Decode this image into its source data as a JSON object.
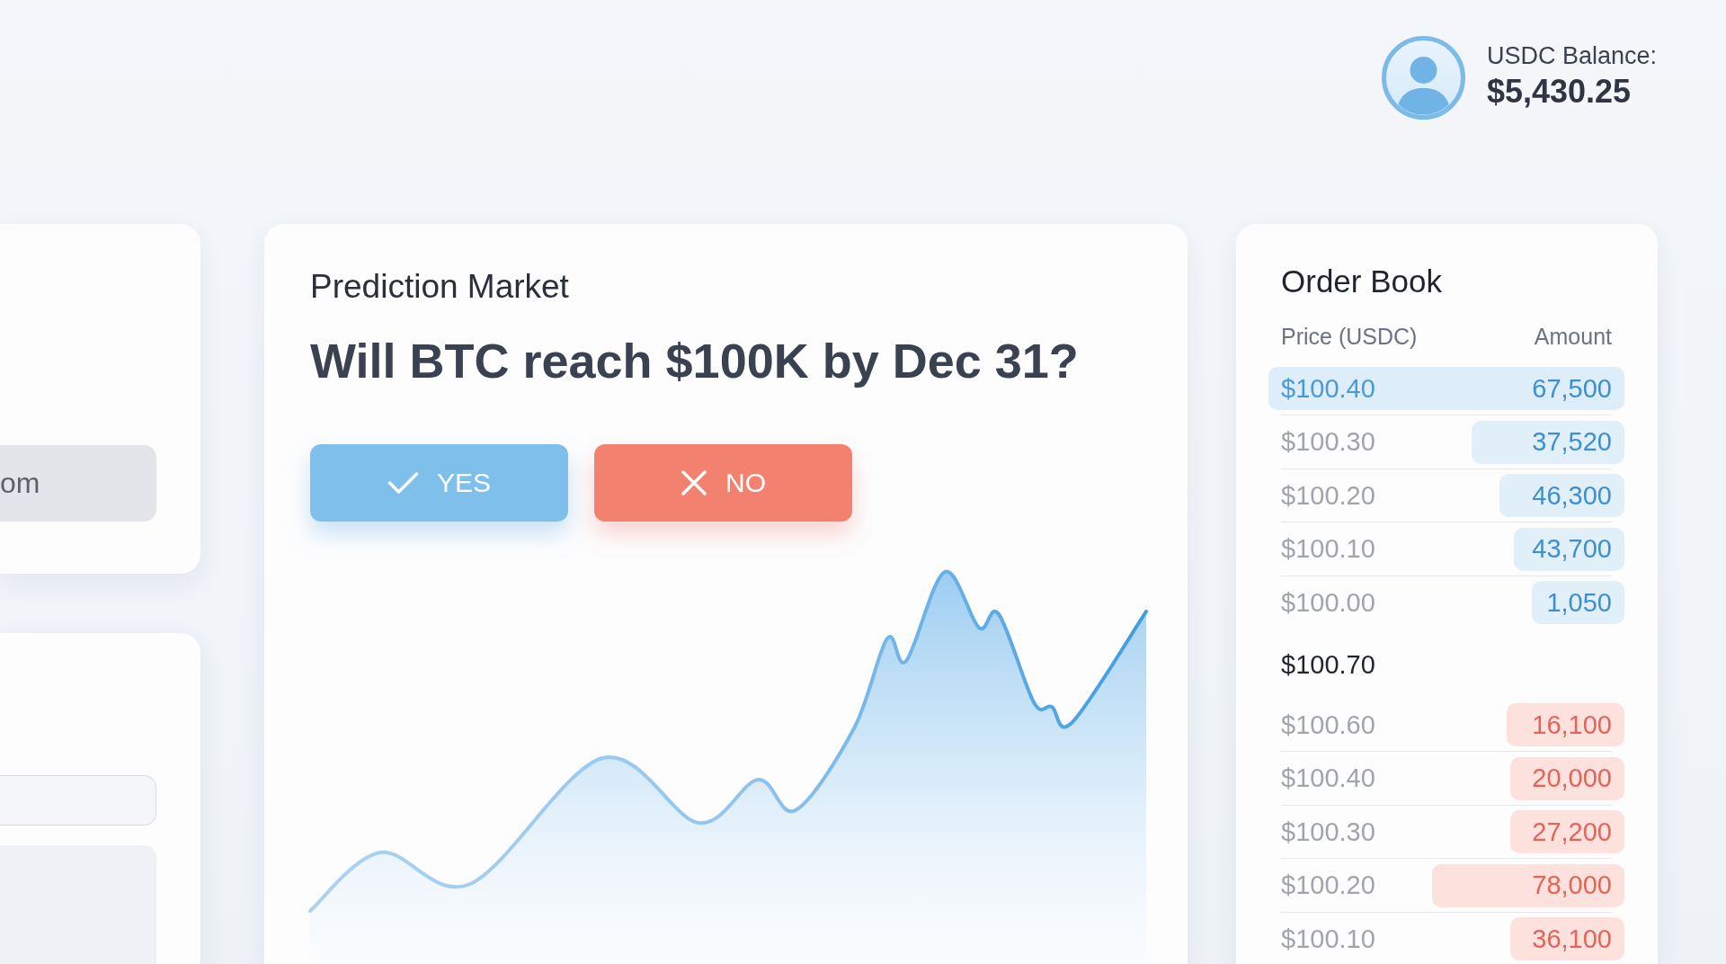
{
  "account": {
    "label": "USDC Balance:",
    "balance": "$5,430.25"
  },
  "left_cards": [
    {
      "kind": "field",
      "value": "om"
    },
    {
      "kind": "form"
    }
  ],
  "market": {
    "section": "Prediction Market",
    "question": "Will BTC reach $100K by Dec 31?",
    "actions": [
      {
        "kind": "yes",
        "label": "YES"
      },
      {
        "kind": "no",
        "label": "NO"
      }
    ]
  },
  "order_book": {
    "title": "Order Book",
    "columns": [
      "Price (USDC)",
      "Amount"
    ],
    "bids": [
      {
        "price": "$100.40",
        "amount": "67,500",
        "selected": true
      },
      {
        "price": "$100.30",
        "amount": "37,520",
        "level": 0.43,
        "selected": false
      },
      {
        "price": "$100.20",
        "amount": "46,300",
        "level": 0.35,
        "selected": false
      },
      {
        "price": "$100.10",
        "amount": "43,700",
        "level": 0.31,
        "selected": false
      },
      {
        "price": "$100.00",
        "amount": "1,050",
        "level": 0.26,
        "selected": false
      }
    ],
    "last_price": "$100.70",
    "asks": [
      {
        "price": "$100.60",
        "amount": "16,100",
        "level": 0.33,
        "selected": false
      },
      {
        "price": "$100.40",
        "amount": "20,000",
        "level": 0.32,
        "selected": false
      },
      {
        "price": "$100.30",
        "amount": "27,200",
        "level": 0.32,
        "selected": false
      },
      {
        "price": "$100.20",
        "amount": "78,000",
        "level": 0.54,
        "selected": false
      },
      {
        "price": "$100.10",
        "amount": "36,100",
        "level": 0.32,
        "selected": false
      }
    ]
  }
}
